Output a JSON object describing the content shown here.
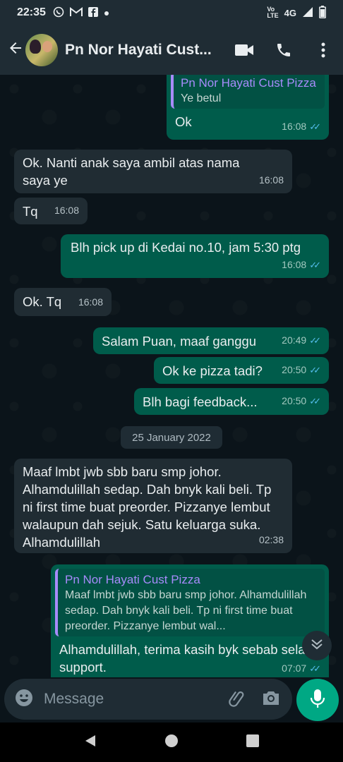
{
  "status_bar": {
    "time": "22:35",
    "left_icons": [
      "whatsapp-icon",
      "gmail-icon",
      "facebook-icon",
      "dot-icon"
    ],
    "network": "4G",
    "right_icons": [
      "volte-icon",
      "signal-icon",
      "battery-icon"
    ]
  },
  "header": {
    "title": "Pn Nor Hayati Cust...",
    "icons": [
      "back-arrow-icon",
      "video-call-icon",
      "phone-icon",
      "more-vert-icon"
    ]
  },
  "messages": [
    {
      "dir": "out",
      "quote_name": "Pn Nor Hayati Cust Pizza",
      "quote_text": "Ye betul",
      "text": "Ok",
      "time": "16:08",
      "read": true
    },
    {
      "dir": "in",
      "text": "Ok. Nanti anak saya ambil atas nama saya ye",
      "time": "16:08"
    },
    {
      "dir": "in",
      "text": "Tq",
      "time": "16:08"
    },
    {
      "dir": "out",
      "text": "Blh pick up di Kedai no.10, jam 5:30 ptg",
      "time": "16:08",
      "read": true
    },
    {
      "dir": "in",
      "text": "Ok. Tq",
      "time": "16:08"
    },
    {
      "dir": "out",
      "text": "Salam Puan, maaf ganggu",
      "time": "20:49",
      "read": true
    },
    {
      "dir": "out",
      "text": "Ok ke pizza tadi?",
      "time": "20:50",
      "read": true
    },
    {
      "dir": "out",
      "text": "Blh bagi feedback...",
      "time": "20:50",
      "read": true
    },
    {
      "dir": "in",
      "text": "Maaf lmbt jwb sbb baru smp johor. Alhamdulillah sedap. Dah bnyk kali beli. Tp ni first time buat preorder. Pizzanye lembut walaupun dah sejuk. Satu keluarga suka. Alhamdulillah",
      "time": "02:38"
    },
    {
      "dir": "out",
      "quote_name": "Pn Nor Hayati Cust Pizza",
      "quote_text": "Maaf lmbt jwb sbb baru smp johor. Alhamdulillah sedap. Dah bnyk kali beli. Tp ni first time buat preorder. Pizzanye lembut wal...",
      "text": "Alhamdulillah, terima kasih byk sebab selalu support.",
      "time": "07:07",
      "read": true
    }
  ],
  "date_chip": "25 January 2022",
  "composer": {
    "placeholder": "Message",
    "icons": [
      "emoji-icon",
      "attach-icon",
      "camera-icon",
      "mic-icon"
    ]
  },
  "colors": {
    "background": "#0b141a",
    "incoming_bubble": "#202c33",
    "outgoing_bubble": "#005c4b",
    "accent": "#00a884",
    "read_tick": "#53bdeb",
    "quote_name": "#a78bfa"
  }
}
